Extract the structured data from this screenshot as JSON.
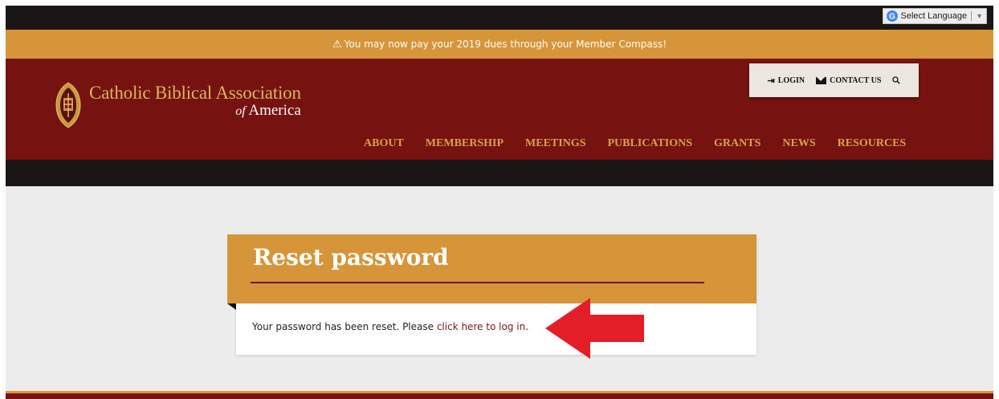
{
  "language": {
    "label": "Select Language",
    "icon": "google-g-icon"
  },
  "notice": {
    "icon": "warning-icon",
    "text": "You may now pay your 2019 dues through your Member Compass!"
  },
  "logo": {
    "line1": "Catholic Biblical Association",
    "of": "of",
    "america": "America"
  },
  "utility": {
    "login": "LOGIN",
    "contact": "CONTACT US",
    "search_icon": "search-icon"
  },
  "nav": [
    "ABOUT",
    "MEMBERSHIP",
    "MEETINGS",
    "PUBLICATIONS",
    "GRANTS",
    "NEWS",
    "RESOURCES"
  ],
  "card": {
    "title": "Reset password",
    "message": "Your password has been reset. Please ",
    "link": "click here to log in",
    "message_end": "."
  },
  "colors": {
    "maroon": "#761310",
    "gold": "#d59538",
    "dark": "#1b1616",
    "annotation_red": "#e41e26"
  }
}
